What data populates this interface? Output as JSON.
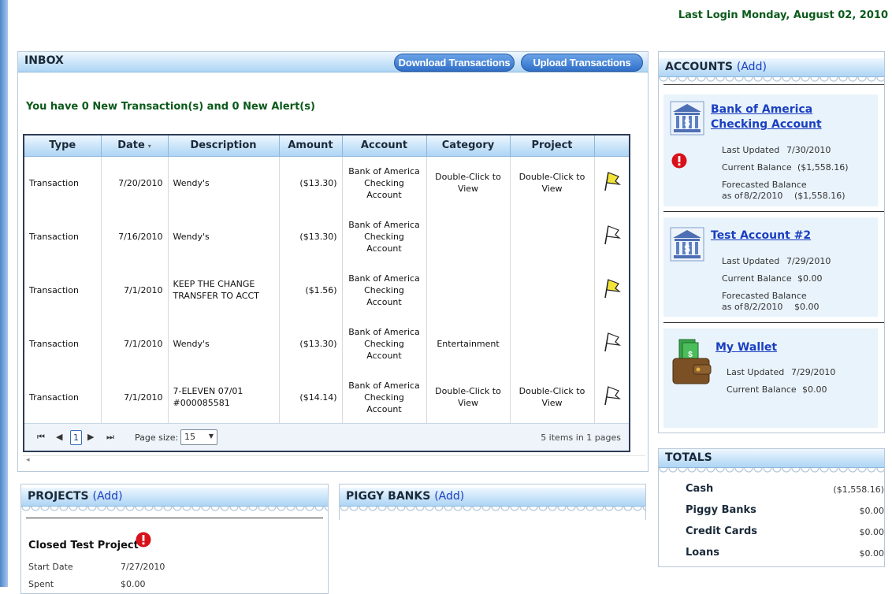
{
  "header": {
    "last_login": "Last Login Monday, August 02, 2010"
  },
  "inbox": {
    "title": "INBOX",
    "download_button": "Download Transactions",
    "upload_button": "Upload Transactions",
    "new_message": "You have 0 New Transaction(s) and 0 New Alert(s)",
    "columns": [
      "Type",
      "Date",
      "Description",
      "Amount",
      "Account",
      "Category",
      "Project"
    ],
    "rows": [
      {
        "type": "Transaction",
        "date": "7/20/2010",
        "description": "Wendy's",
        "amount": "($13.30)",
        "account": "Bank of America Checking Account",
        "category": "Double-Click to View",
        "project": "Double-Click to View",
        "flag": "yellow"
      },
      {
        "type": "Transaction",
        "date": "7/16/2010",
        "description": "Wendy's",
        "amount": "($13.30)",
        "account": "Bank of America Checking Account",
        "category": "",
        "project": "",
        "flag": "white"
      },
      {
        "type": "Transaction",
        "date": "7/1/2010",
        "description": "KEEP THE CHANGE TRANSFER TO ACCT",
        "amount": "($1.56)",
        "account": "Bank of America Checking Account",
        "category": "",
        "project": "",
        "flag": "yellow"
      },
      {
        "type": "Transaction",
        "date": "7/1/2010",
        "description": "Wendy's",
        "amount": "($13.30)",
        "account": "Bank of America Checking Account",
        "category": "Entertainment",
        "project": "",
        "flag": "white"
      },
      {
        "type": "Transaction",
        "date": "7/1/2010",
        "description": "7-ELEVEN 07/01 #000085581",
        "amount": "($14.14)",
        "account": "Bank of America Checking Account",
        "category": "Double-Click to View",
        "project": "Double-Click to View",
        "flag": "white"
      }
    ],
    "pager": {
      "current_page": "1",
      "page_size_label": "Page size:",
      "page_size": "15",
      "info": "5 items in 1 pages"
    }
  },
  "accounts": {
    "title": "ACCOUNTS",
    "add_label": "(Add)",
    "items": [
      {
        "name": "Bank of America Checking Account",
        "last_updated_label": "Last Updated",
        "last_updated": "7/30/2010",
        "current_balance_label": "Current Balance",
        "current_balance": "($1,558.16)",
        "forecast_label": "Forecasted Balance",
        "forecast_asof": "as of",
        "forecast_date": "8/2/2010",
        "forecast_value": "($1,558.16)"
      },
      {
        "name": "Test Account #2",
        "last_updated_label": "Last Updated",
        "last_updated": "7/29/2010",
        "current_balance_label": "Current Balance",
        "current_balance": "$0.00",
        "forecast_label": "Forecasted Balance",
        "forecast_asof": "as of",
        "forecast_date": "8/2/2010",
        "forecast_value": "$0.00"
      },
      {
        "name": "My Wallet",
        "last_updated_label": "Last Updated",
        "last_updated": "7/29/2010",
        "current_balance_label": "Current Balance",
        "current_balance": "$0.00"
      }
    ]
  },
  "totals": {
    "title": "TOTALS",
    "rows": [
      {
        "label": "Cash",
        "value": "($1,558.16)"
      },
      {
        "label": "Piggy Banks",
        "value": "$0.00"
      },
      {
        "label": "Credit Cards",
        "value": "$0.00"
      },
      {
        "label": "Loans",
        "value": "$0.00"
      }
    ]
  },
  "projects": {
    "title": "PROJECTS",
    "add_label": "(Add)",
    "item": {
      "name": "Closed Test Project",
      "start_label": "Start Date",
      "start_value": "7/27/2010",
      "spent_label": "Spent",
      "spent_value": "$0.00"
    }
  },
  "piggy_banks": {
    "title": "PIGGY BANKS",
    "add_label": "(Add)"
  },
  "colors": {
    "accent": "#2f6fc8",
    "alert": "#0a5a1a",
    "link": "#1a3fc0",
    "flag_yellow": "#f3e43a"
  },
  "icons": [
    "bank-icon",
    "wallet-icon",
    "alert-icon",
    "flag-icon",
    "first-page-icon",
    "prev-page-icon",
    "next-page-icon",
    "last-page-icon"
  ]
}
